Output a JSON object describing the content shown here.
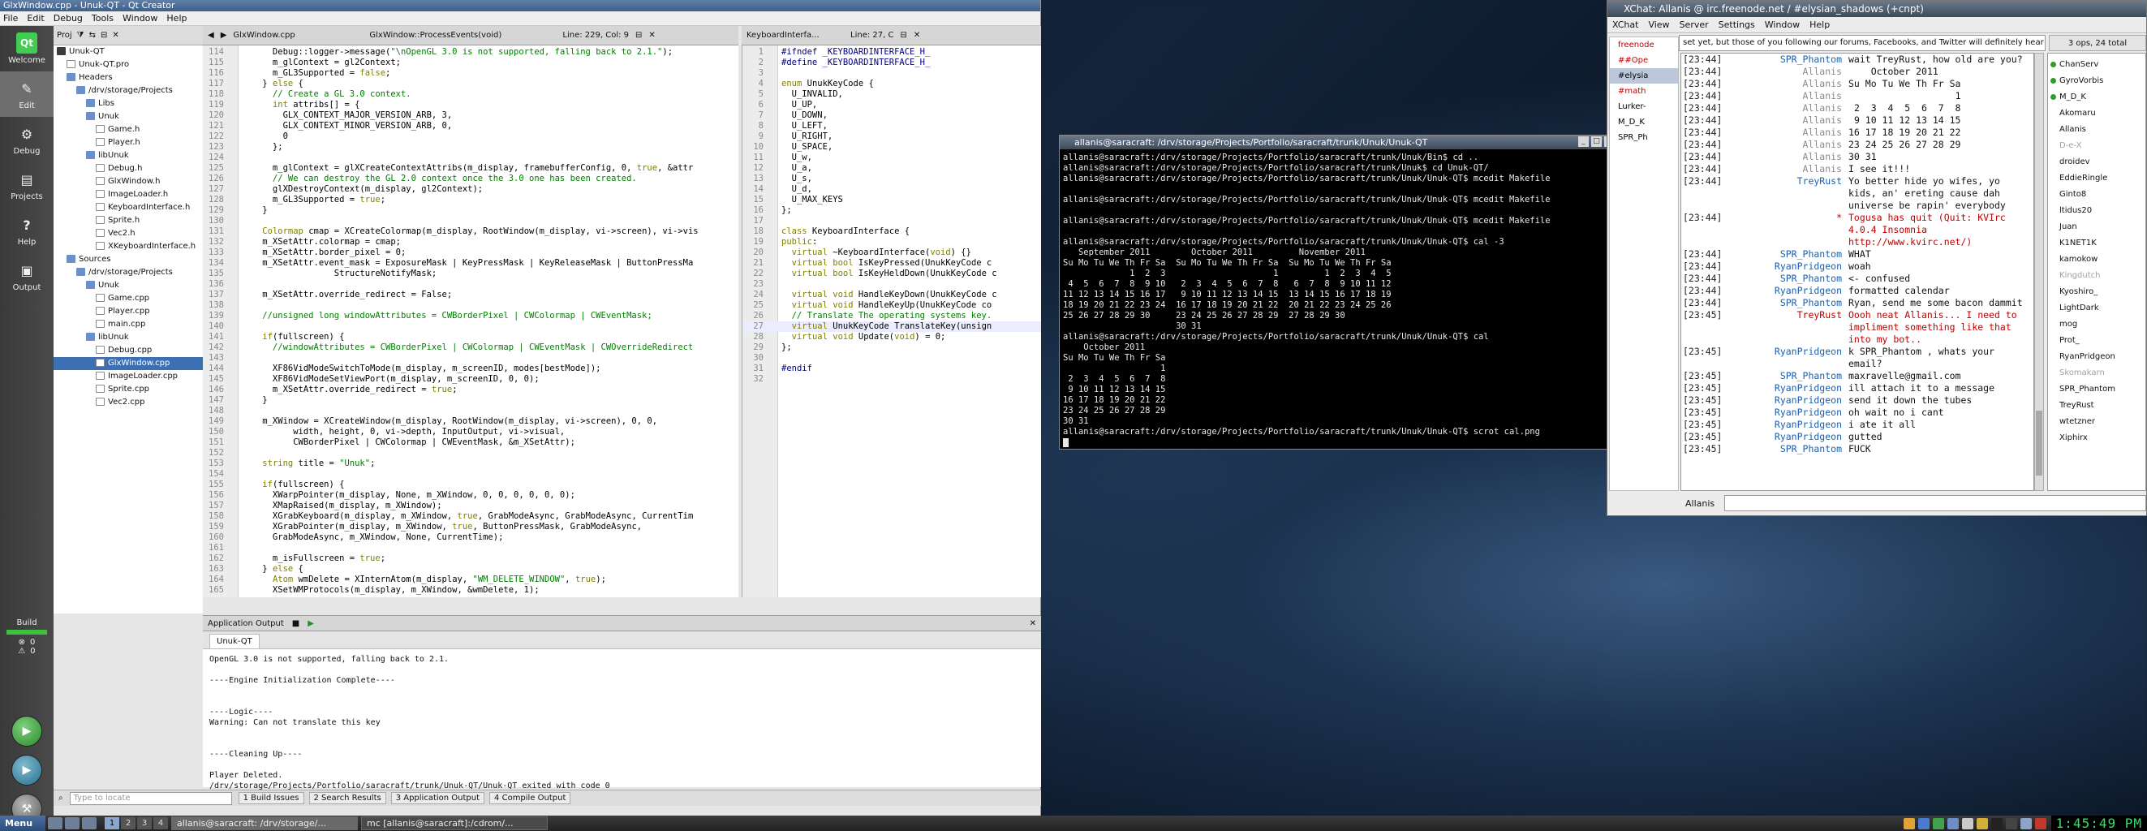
{
  "qt": {
    "title": "GlxWindow.cpp - Unuk-QT - Qt Creator",
    "menus": [
      "File",
      "Edit",
      "Debug",
      "Tools",
      "Window",
      "Help"
    ],
    "modes": [
      {
        "label": "Welcome",
        "glyph": "Qt"
      },
      {
        "label": "Edit",
        "glyph": "✎"
      },
      {
        "label": "Debug",
        "glyph": "⚙"
      },
      {
        "label": "Projects",
        "glyph": "▤"
      },
      {
        "label": "Help",
        "glyph": "?"
      },
      {
        "label": "Output",
        "glyph": "▣"
      }
    ],
    "build_label": "Build",
    "build_errors": "0",
    "build_warnings": "0",
    "proj_toolbar_label": "Proj",
    "tree": [
      {
        "depth": 0,
        "icon": "proj",
        "label": "Unuk-QT"
      },
      {
        "depth": 1,
        "icon": "file",
        "label": "Unuk-QT.pro"
      },
      {
        "depth": 1,
        "icon": "dir",
        "label": "Headers"
      },
      {
        "depth": 2,
        "icon": "dir",
        "label": "/drv/storage/Projects"
      },
      {
        "depth": 3,
        "icon": "dir",
        "label": "Libs"
      },
      {
        "depth": 3,
        "icon": "dir",
        "label": "Unuk"
      },
      {
        "depth": 4,
        "icon": "file",
        "label": "Game.h"
      },
      {
        "depth": 4,
        "icon": "file",
        "label": "Player.h"
      },
      {
        "depth": 3,
        "icon": "dir",
        "label": "libUnuk"
      },
      {
        "depth": 4,
        "icon": "file",
        "label": "Debug.h"
      },
      {
        "depth": 4,
        "icon": "file",
        "label": "GlxWindow.h"
      },
      {
        "depth": 4,
        "icon": "file",
        "label": "ImageLoader.h"
      },
      {
        "depth": 4,
        "icon": "file",
        "label": "KeyboardInterface.h"
      },
      {
        "depth": 4,
        "icon": "file",
        "label": "Sprite.h"
      },
      {
        "depth": 4,
        "icon": "file",
        "label": "Vec2.h"
      },
      {
        "depth": 4,
        "icon": "file",
        "label": "XKeyboardInterface.h"
      },
      {
        "depth": 1,
        "icon": "dir",
        "label": "Sources"
      },
      {
        "depth": 2,
        "icon": "dir",
        "label": "/drv/storage/Projects"
      },
      {
        "depth": 3,
        "icon": "dir",
        "label": "Unuk"
      },
      {
        "depth": 4,
        "icon": "file",
        "label": "Game.cpp"
      },
      {
        "depth": 4,
        "icon": "file",
        "label": "Player.cpp"
      },
      {
        "depth": 4,
        "icon": "file",
        "label": "main.cpp"
      },
      {
        "depth": 3,
        "icon": "dir",
        "label": "libUnuk"
      },
      {
        "depth": 4,
        "icon": "file",
        "label": "Debug.cpp"
      },
      {
        "depth": 4,
        "icon": "file",
        "label": "GlxWindow.cpp",
        "selected": true
      },
      {
        "depth": 4,
        "icon": "file",
        "label": "ImageLoader.cpp"
      },
      {
        "depth": 4,
        "icon": "file",
        "label": "Sprite.cpp"
      },
      {
        "depth": 4,
        "icon": "file",
        "label": "Vec2.cpp"
      }
    ],
    "editor1": {
      "file": "GlxWindow.cpp",
      "symbol": "GlxWindow::ProcessEvents(void)",
      "position": "Line: 229, Col: 9",
      "lines": [
        [
          "114",
          "      Debug::logger->message(\"\\nOpenGL 3.0 is not supported, falling back to 2.1.\");"
        ],
        [
          "115",
          "      m_glContext = gl2Context;"
        ],
        [
          "116",
          "      m_GL3Supported = false;"
        ],
        [
          "117",
          "    } else {"
        ],
        [
          "118",
          "      // Create a GL 3.0 context."
        ],
        [
          "119",
          "      int attribs[] = {"
        ],
        [
          "120",
          "        GLX_CONTEXT_MAJOR_VERSION_ARB, 3,"
        ],
        [
          "121",
          "        GLX_CONTEXT_MINOR_VERSION_ARB, 0,"
        ],
        [
          "122",
          "        0"
        ],
        [
          "123",
          "      };"
        ],
        [
          "124",
          ""
        ],
        [
          "125",
          "      m_glContext = glXCreateContextAttribs(m_display, framebufferConfig, 0, true, &attr"
        ],
        [
          "126",
          "      // We can destroy the GL 2.0 context once the 3.0 one has been created."
        ],
        [
          "127",
          "      glXDestroyContext(m_display, gl2Context);"
        ],
        [
          "128",
          "      m_GL3Supported = true;"
        ],
        [
          "129",
          "    }"
        ],
        [
          "130",
          ""
        ],
        [
          "131",
          "    Colormap cmap = XCreateColormap(m_display, RootWindow(m_display, vi->screen), vi->vis"
        ],
        [
          "132",
          "    m_XSetAttr.colormap = cmap;"
        ],
        [
          "133",
          "    m_XSetAttr.border_pixel = 0;"
        ],
        [
          "134",
          "    m_XSetAttr.event_mask = ExposureMask | KeyPressMask | KeyReleaseMask | ButtonPressMa"
        ],
        [
          "135",
          "                  StructureNotifyMask;"
        ],
        [
          "136",
          ""
        ],
        [
          "137",
          "    m_XSetAttr.override_redirect = False;"
        ],
        [
          "138",
          ""
        ],
        [
          "139",
          "    //unsigned long windowAttributes = CWBorderPixel | CWColormap | CWEventMask;"
        ],
        [
          "140",
          ""
        ],
        [
          "141",
          "    if(fullscreen) {"
        ],
        [
          "142",
          "      //windowAttributes = CWBorderPixel | CWColormap | CWEventMask | CWOverrideRedirect"
        ],
        [
          "143",
          ""
        ],
        [
          "144",
          "      XF86VidModeSwitchToMode(m_display, m_screenID, modes[bestMode]);"
        ],
        [
          "145",
          "      XF86VidModeSetViewPort(m_display, m_screenID, 0, 0);"
        ],
        [
          "146",
          "      m_XSetAttr.override_redirect = true;"
        ],
        [
          "147",
          "    }"
        ],
        [
          "148",
          ""
        ],
        [
          "149",
          "    m_XWindow = XCreateWindow(m_display, RootWindow(m_display, vi->screen), 0, 0,"
        ],
        [
          "150",
          "          width, height, 0, vi->depth, InputOutput, vi->visual,"
        ],
        [
          "151",
          "          CWBorderPixel | CWColormap | CWEventMask, &m_XSetAttr);"
        ],
        [
          "152",
          ""
        ],
        [
          "153",
          "    string title = \"Unuk\";"
        ],
        [
          "154",
          ""
        ],
        [
          "155",
          "    if(fullscreen) {"
        ],
        [
          "156",
          "      XWarpPointer(m_display, None, m_XWindow, 0, 0, 0, 0, 0, 0);"
        ],
        [
          "157",
          "      XMapRaised(m_display, m_XWindow);"
        ],
        [
          "158",
          "      XGrabKeyboard(m_display, m_XWindow, true, GrabModeAsync, GrabModeAsync, CurrentTim"
        ],
        [
          "159",
          "      XGrabPointer(m_display, m_XWindow, true, ButtonPressMask, GrabModeAsync,"
        ],
        [
          "160",
          "      GrabModeAsync, m_XWindow, None, CurrentTime);"
        ],
        [
          "161",
          ""
        ],
        [
          "162",
          "      m_isFullscreen = true;"
        ],
        [
          "163",
          "    } else {"
        ],
        [
          "164",
          "      Atom wmDelete = XInternAtom(m_display, \"WM_DELETE_WINDOW\", true);"
        ],
        [
          "165",
          "      XSetWMProtocols(m_display, m_XWindow, &wmDelete, 1);"
        ]
      ]
    },
    "editor2": {
      "file": "KeyboardInterfa...",
      "position": "Line: 27, C",
      "lines": [
        [
          "1",
          "#ifndef _KEYBOARDINTERFACE_H_"
        ],
        [
          "2",
          "#define _KEYBOARDINTERFACE_H_"
        ],
        [
          "3",
          ""
        ],
        [
          "4",
          "enum UnukKeyCode {"
        ],
        [
          "5",
          "  U_INVALID,"
        ],
        [
          "6",
          "  U_UP,"
        ],
        [
          "7",
          "  U_DOWN,"
        ],
        [
          "8",
          "  U_LEFT,"
        ],
        [
          "9",
          "  U_RIGHT,"
        ],
        [
          "10",
          "  U_SPACE,"
        ],
        [
          "11",
          "  U_w,"
        ],
        [
          "12",
          "  U_a,"
        ],
        [
          "13",
          "  U_s,"
        ],
        [
          "14",
          "  U_d,"
        ],
        [
          "15",
          "  U_MAX_KEYS"
        ],
        [
          "16",
          "};"
        ],
        [
          "17",
          ""
        ],
        [
          "18",
          "class KeyboardInterface {"
        ],
        [
          "19",
          "public:"
        ],
        [
          "20",
          "  virtual ~KeyboardInterface(void) {}"
        ],
        [
          "21",
          "  virtual bool IsKeyPressed(UnukKeyCode c"
        ],
        [
          "22",
          "  virtual bool IsKeyHeldDown(UnukKeyCode c"
        ],
        [
          "23",
          ""
        ],
        [
          "24",
          "  virtual void HandleKeyDown(UnukKeyCode c"
        ],
        [
          "25",
          "  virtual void HandleKeyUp(UnukKeyCode co"
        ],
        [
          "26",
          "  // Translate The operating systems key."
        ],
        [
          "27",
          "  virtual UnukKeyCode TranslateKey(unsign"
        ],
        [
          "28",
          "  virtual void Update(void) = 0;"
        ],
        [
          "29",
          "};"
        ],
        [
          "30",
          ""
        ],
        [
          "31",
          "#endif"
        ],
        [
          "32",
          ""
        ]
      ]
    },
    "output": {
      "pane_title": "Application Output",
      "tab": "Unuk-QT",
      "lines": [
        "OpenGL 3.0 is not supported, falling back to 2.1.",
        "",
        "----Engine Initialization Complete----",
        "",
        "",
        "----Logic----",
        "Warning: Can not translate this key",
        "",
        "",
        "----Cleaning Up----",
        "",
        "Player Deleted.",
        "/drv/storage/Projects/Portfolio/saracraft/trunk/Unuk-QT/Unuk-QT exited with code 0"
      ]
    },
    "status": {
      "locator_placeholder": "Type to locate",
      "panes": [
        "1  Build Issues",
        "2  Search Results",
        "3  Application Output",
        "4  Compile Output"
      ]
    }
  },
  "terminal": {
    "title": "allanis@saracraft: /drv/storage/Projects/Portfolio/saracraft/trunk/Unuk/Unuk-QT",
    "lines": [
      "allanis@saracraft:/drv/storage/Projects/Portfolio/saracraft/trunk/Unuk/Bin$ cd ..",
      "allanis@saracraft:/drv/storage/Projects/Portfolio/saracraft/trunk/Unuk$ cd Unuk-QT/",
      "allanis@saracraft:/drv/storage/Projects/Portfolio/saracraft/trunk/Unuk/Unuk-QT$ mcedit Makefile",
      "",
      "allanis@saracraft:/drv/storage/Projects/Portfolio/saracraft/trunk/Unuk/Unuk-QT$ mcedit Makefile",
      "",
      "allanis@saracraft:/drv/storage/Projects/Portfolio/saracraft/trunk/Unuk/Unuk-QT$ mcedit Makefile",
      "",
      "allanis@saracraft:/drv/storage/Projects/Portfolio/saracraft/trunk/Unuk/Unuk-QT$ cal -3",
      "   September 2011        October 2011         November 2011",
      "Su Mo Tu We Th Fr Sa  Su Mo Tu We Th Fr Sa  Su Mo Tu We Th Fr Sa",
      "             1  2  3                     1         1  2  3  4  5",
      " 4  5  6  7  8  9 10   2  3  4  5  6  7  8   6  7  8  9 10 11 12",
      "11 12 13 14 15 16 17   9 10 11 12 13 14 15  13 14 15 16 17 18 19",
      "18 19 20 21 22 23 24  16 17 18 19 20 21 22  20 21 22 23 24 25 26",
      "25 26 27 28 29 30     23 24 25 26 27 28 29  27 28 29 30",
      "                      30 31",
      "allanis@saracraft:/drv/storage/Projects/Portfolio/saracraft/trunk/Unuk/Unuk-QT$ cal",
      "    October 2011",
      "Su Mo Tu We Th Fr Sa",
      "                   1",
      " 2  3  4  5  6  7  8",
      " 9 10 11 12 13 14 15",
      "16 17 18 19 20 21 22",
      "23 24 25 26 27 28 29",
      "30 31",
      "allanis@saracraft:/drv/storage/Projects/Portfolio/saracraft/trunk/Unuk/Unuk-QT$ scrot cal.png"
    ]
  },
  "xchat": {
    "title": "XChat: Allanis @ irc.freenode.net / #elysian_shadows (+cnpt)",
    "menus": [
      "XChat",
      "View",
      "Server",
      "Settings",
      "Window",
      "Help"
    ],
    "topic": "set yet, but those of you following our forums, Facebooks, and Twitter will definitely hear more",
    "ops": "3 ops, 24 total",
    "channels": [
      {
        "name": "freenode",
        "color": "#c00000"
      },
      {
        "name": "##Ope",
        "color": "#c00000"
      },
      {
        "name": "#elysia",
        "color": "#000000",
        "selected": true
      },
      {
        "name": "#math",
        "color": "#c00000"
      },
      {
        "name": "Lurker-",
        "color": "#000000"
      },
      {
        "name": "M_D_K",
        "color": "#000000"
      },
      {
        "name": "SPR_Ph",
        "color": "#000000"
      }
    ],
    "messages": [
      {
        "t": "[23:44]",
        "n": "SPR_Phantom",
        "nc": "#1a5fb0",
        "m": "wait TreyRust, how old are you?"
      },
      {
        "t": "[23:44]",
        "n": "Allanis",
        "nc": "#8a8a8a",
        "m": "    October 2011"
      },
      {
        "t": "[23:44]",
        "n": "Allanis",
        "nc": "#8a8a8a",
        "m": "Su Mo Tu We Th Fr Sa"
      },
      {
        "t": "[23:44]",
        "n": "Allanis",
        "nc": "#8a8a8a",
        "m": "                   1"
      },
      {
        "t": "[23:44]",
        "n": "Allanis",
        "nc": "#8a8a8a",
        "m": " 2  3  4  5  6  7  8"
      },
      {
        "t": "[23:44]",
        "n": "Allanis",
        "nc": "#8a8a8a",
        "m": " 9 10 11 12 13 14 15"
      },
      {
        "t": "[23:44]",
        "n": "Allanis",
        "nc": "#8a8a8a",
        "m": "16 17 18 19 20 21 22"
      },
      {
        "t": "[23:44]",
        "n": "Allanis",
        "nc": "#8a8a8a",
        "m": "23 24 25 26 27 28 29"
      },
      {
        "t": "[23:44]",
        "n": "Allanis",
        "nc": "#8a8a8a",
        "m": "30 31"
      },
      {
        "t": "[23:44]",
        "n": "Allanis",
        "nc": "#8a8a8a",
        "m": "I see it!!!"
      },
      {
        "t": "[23:44]",
        "n": "TreyRust",
        "nc": "#1a5fb0",
        "m": "Yo better hide yo wifes, yo kids, an' ereting cause dah universe be rapin' everybody"
      },
      {
        "t": "[23:44]",
        "n": "*",
        "nc": "#c00000",
        "m": "Togusa has quit (Quit: KVIrc 4.0.4 Insomnia http://www.kvirc.net/)",
        "mc": "#c00000"
      },
      {
        "t": "[23:44]",
        "n": "SPR_Phantom",
        "nc": "#1a5fb0",
        "m": "WHAT"
      },
      {
        "t": "[23:44]",
        "n": "RyanPridgeon",
        "nc": "#1a5fb0",
        "m": "woah"
      },
      {
        "t": "[23:44]",
        "n": "SPR_Phantom",
        "nc": "#1a5fb0",
        "m": "<- confused"
      },
      {
        "t": "[23:44]",
        "n": "RyanPridgeon",
        "nc": "#1a5fb0",
        "m": "formatted calendar"
      },
      {
        "t": "[23:44]",
        "n": "SPR_Phantom",
        "nc": "#1a5fb0",
        "m": "Ryan, send me some bacon dammit"
      },
      {
        "t": "[23:45]",
        "n": "TreyRust",
        "nc": "#c00000",
        "m": "Oooh neat Allanis... I need to impliment something like that into my bot..",
        "mc": "#c00000"
      },
      {
        "t": "[23:45]",
        "n": "RyanPridgeon",
        "nc": "#1a5fb0",
        "m": "k SPR_Phantom , whats your email?"
      },
      {
        "t": "[23:45]",
        "n": "SPR_Phantom",
        "nc": "#1a5fb0",
        "m": "maxravelle@gmail.com"
      },
      {
        "t": "[23:45]",
        "n": "RyanPridgeon",
        "nc": "#1a5fb0",
        "m": "ill attach it to a message"
      },
      {
        "t": "[23:45]",
        "n": "RyanPridgeon",
        "nc": "#1a5fb0",
        "m": "send it down the tubes"
      },
      {
        "t": "[23:45]",
        "n": "RyanPridgeon",
        "nc": "#1a5fb0",
        "m": "oh wait no i cant"
      },
      {
        "t": "[23:45]",
        "n": "RyanPridgeon",
        "nc": "#1a5fb0",
        "m": "i ate it all"
      },
      {
        "t": "[23:45]",
        "n": "RyanPridgeon",
        "nc": "#1a5fb0",
        "m": "gutted"
      },
      {
        "t": "[23:45]",
        "n": "SPR_Phantom",
        "nc": "#1a5fb0",
        "m": "FUCK"
      }
    ],
    "users": [
      {
        "name": "ChanServ",
        "dot": "#2aa02a"
      },
      {
        "name": "GyroVorbis",
        "dot": "#2aa02a"
      },
      {
        "name": "M_D_K",
        "dot": "#2aa02a"
      },
      {
        "name": "Akomaru",
        "dot": ""
      },
      {
        "name": "Allanis",
        "dot": ""
      },
      {
        "name": "D-e-X",
        "dot": "",
        "dim": true
      },
      {
        "name": "droidev",
        "dot": ""
      },
      {
        "name": "EddieRingle",
        "dot": ""
      },
      {
        "name": "Ginto8",
        "dot": ""
      },
      {
        "name": "ltidus20",
        "dot": ""
      },
      {
        "name": "Juan",
        "dot": ""
      },
      {
        "name": "K1NET1K",
        "dot": ""
      },
      {
        "name": "kamokow",
        "dot": ""
      },
      {
        "name": "Kingdutch",
        "dot": "",
        "dim": true
      },
      {
        "name": "Kyoshiro_",
        "dot": ""
      },
      {
        "name": "LightDark",
        "dot": ""
      },
      {
        "name": "mog",
        "dot": ""
      },
      {
        "name": "Prot_",
        "dot": ""
      },
      {
        "name": "RyanPridgeon",
        "dot": ""
      },
      {
        "name": "Skomakarn",
        "dot": "",
        "dim": true
      },
      {
        "name": "SPR_Phantom",
        "dot": ""
      },
      {
        "name": "TreyRust",
        "dot": ""
      },
      {
        "name": "wtetzner",
        "dot": ""
      },
      {
        "name": "Xiphirx",
        "dot": ""
      }
    ],
    "nick": "Allanis"
  },
  "panel": {
    "menu_label": "Menu",
    "desktops": [
      "1",
      "2",
      "3",
      "4"
    ],
    "tasks": [
      "allanis@saracraft: /drv/storage/...",
      "mc [allanis@saracraft]:/cdrom/..."
    ],
    "clock": "1:45:49 PM",
    "tray_colors": [
      "#e2a23a",
      "#4a7bd0",
      "#3fa34d",
      "#6d8fc7",
      "#c9c9c9",
      "#d0b03a",
      "#222222",
      "#444444",
      "#8da3c7",
      "#c0392b"
    ]
  },
  "colors": {
    "keyword": "#808000",
    "comment": "#008000",
    "string": "#008000",
    "number": "#000080",
    "macro": "#000080",
    "selection": "#3d6fb4"
  }
}
